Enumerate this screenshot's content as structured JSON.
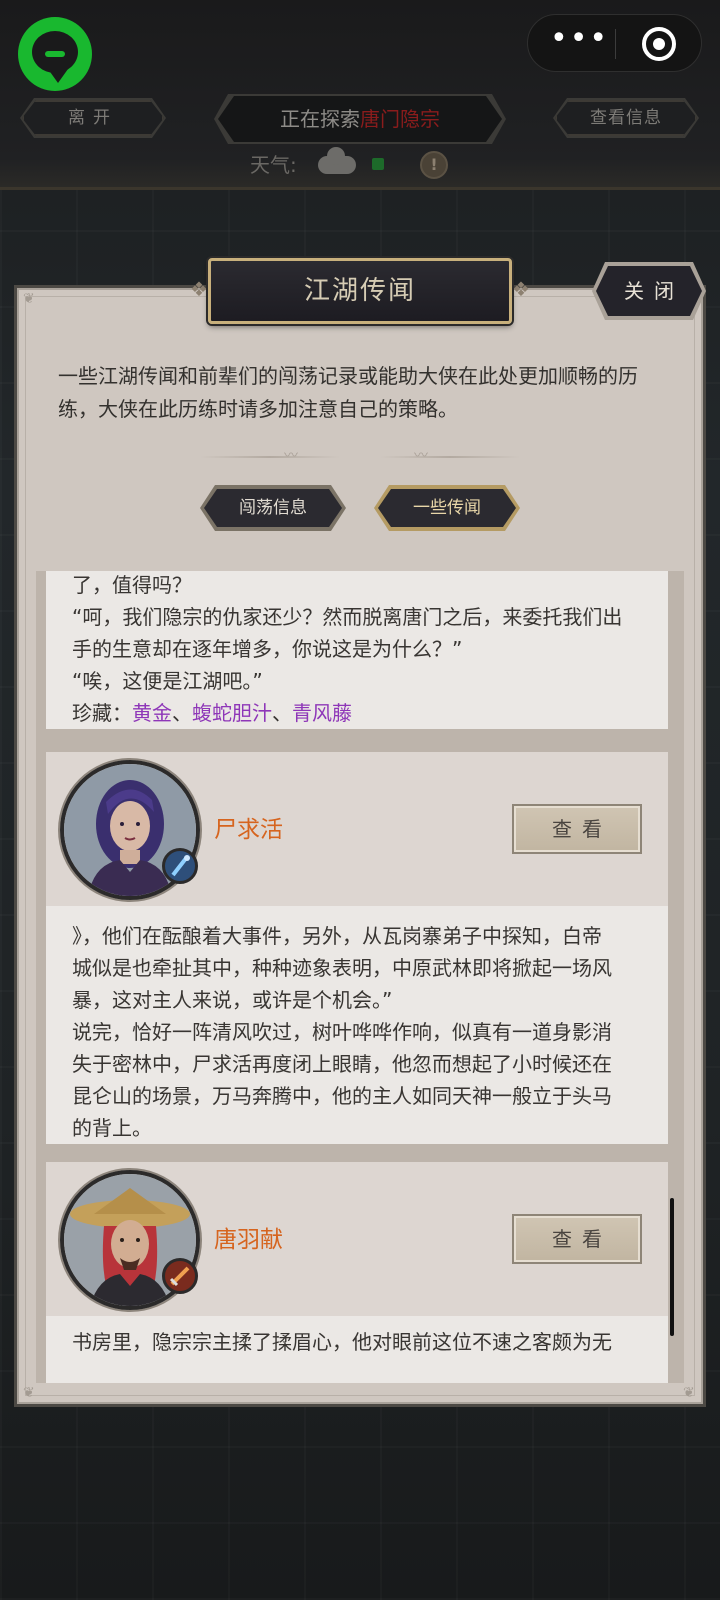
{
  "topbar": {
    "leave_label": "离开",
    "exploring_prefix": "正在探索",
    "exploring_place": "唐门隐宗",
    "info_label": "查看信息",
    "weather_label": "天气:"
  },
  "modal": {
    "title": "江湖传闻",
    "close_label": "关闭",
    "intro": "一些江湖传闻和前辈们的闯荡记录或能助大侠在此处更加顺畅的历练，大侠在此历练时请多加注意自己的策略。",
    "tabs": [
      {
        "label": "闯荡信息",
        "active": false
      },
      {
        "label": "一些传闻",
        "active": true
      }
    ]
  },
  "entries": {
    "first_story": {
      "lines": [
        "了，值得吗？",
        "“呵，我们隐宗的仇家还少？然而脱离唐门之后，来委托我们出",
        "手的生意却在逐年增多，你说这是为什么？”",
        "“唉，这便是江湖吧。”"
      ],
      "treasure_prefix": "珍藏：",
      "treasures": [
        "黄金",
        "蝮蛇胆汁",
        "青风藤"
      ],
      "separator": "、"
    },
    "heroes": [
      {
        "name": "尸求活",
        "view_label": "查看",
        "story_lines": [
          "》，他们在酝酿着大事件，另外，从瓦岗寨弟子中探知，白帝",
          "城似是也牵扯其中，种种迹象表明，中原武林即将掀起一场风",
          "暴，这对主人来说，或许是个机会。”",
          "说完，恰好一阵清风吹过，树叶哗哗作响，似真有一道身影消",
          "失于密林中，尸求活再度闭上眼睛，他忽而想起了小时候还在",
          "昆仑山的场景，万马奔腾中，他的主人如同天神一般立于头马",
          "的背上。"
        ]
      },
      {
        "name": "唐羽献",
        "view_label": "查看",
        "story_lines": [
          "书房里，隐宗宗主揉了揉眉心，他对眼前这位不速之客颇为无"
        ]
      }
    ]
  },
  "colors": {
    "accent_name": "#d6641e",
    "treasure": "#8e36b8",
    "place": "#8a1c1c",
    "logo": "#19b82f"
  }
}
